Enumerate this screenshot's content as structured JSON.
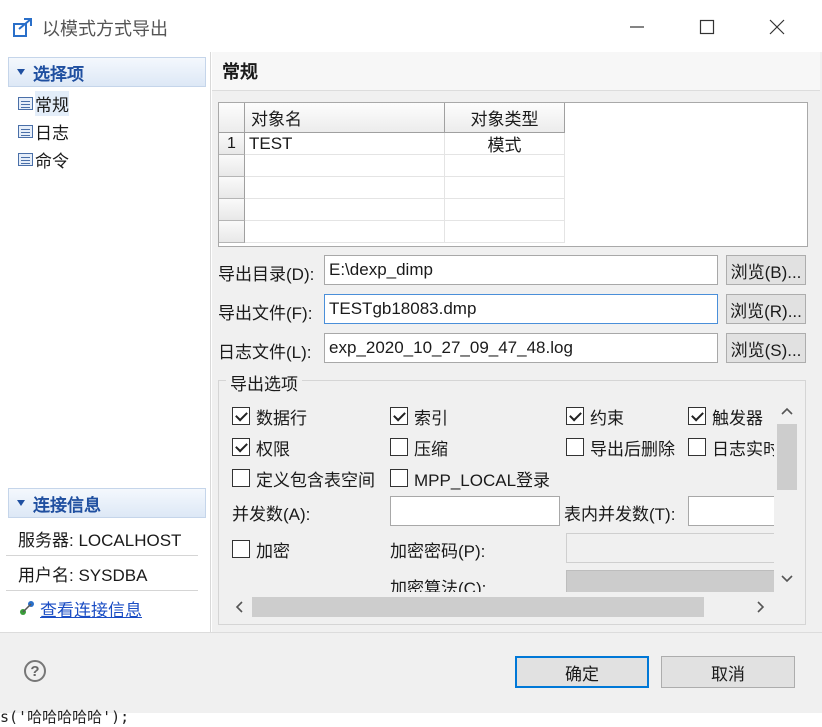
{
  "window": {
    "title": "以模式方式导出"
  },
  "left": {
    "options_header": "选择项",
    "tree": [
      {
        "label": "常规"
      },
      {
        "label": "日志"
      },
      {
        "label": "命令"
      }
    ],
    "conn_header": "连接信息",
    "server": "服务器: LOCALHOST",
    "user": "用户名: SYSDBA",
    "view_link": "查看连接信息"
  },
  "main": {
    "section_title": "常规",
    "table": {
      "columns": [
        "对象名",
        "对象类型"
      ],
      "rows": [
        {
          "num": "1",
          "name": "TEST",
          "type": "模式"
        }
      ]
    },
    "export_dir_label": "导出目录(D):",
    "export_dir_value": "E:\\dexp_dimp",
    "export_dir_browse": "浏览(B)...",
    "export_file_label": "导出文件(F):",
    "export_file_value": "TESTgb18083.dmp",
    "export_file_browse": "浏览(R)...",
    "log_file_label": "日志文件(L):",
    "log_file_value": "exp_2020_10_27_09_47_48.log",
    "log_file_browse": "浏览(S)...",
    "options_group_title": "导出选项",
    "options": {
      "rows": {
        "label": "数据行",
        "checked": true
      },
      "index": {
        "label": "索引",
        "checked": true
      },
      "constraint": {
        "label": "约束",
        "checked": true
      },
      "trigger": {
        "label": "触发器",
        "checked": true
      },
      "grants": {
        "label": "权限",
        "checked": true
      },
      "compress": {
        "label": "压缩",
        "checked": false
      },
      "drop_after": {
        "label": "导出后删除",
        "checked": false
      },
      "log_realtime": {
        "label": "日志实时",
        "checked": false
      },
      "tablespace": {
        "label": "定义包含表空间",
        "checked": false
      },
      "mpp_local": {
        "label": "MPP_LOCAL登录",
        "checked": false
      },
      "parallel_label": "并发数(A):",
      "table_parallel_label": "表内并发数(T):",
      "encrypt": {
        "label": "加密",
        "checked": false
      },
      "encrypt_pwd_label": "加密密码(P):",
      "encrypt_algo_label": "加密算法(C):"
    }
  },
  "footer": {
    "ok": "确定",
    "cancel": "取消"
  },
  "background_text": "s('哈哈哈哈哈');"
}
